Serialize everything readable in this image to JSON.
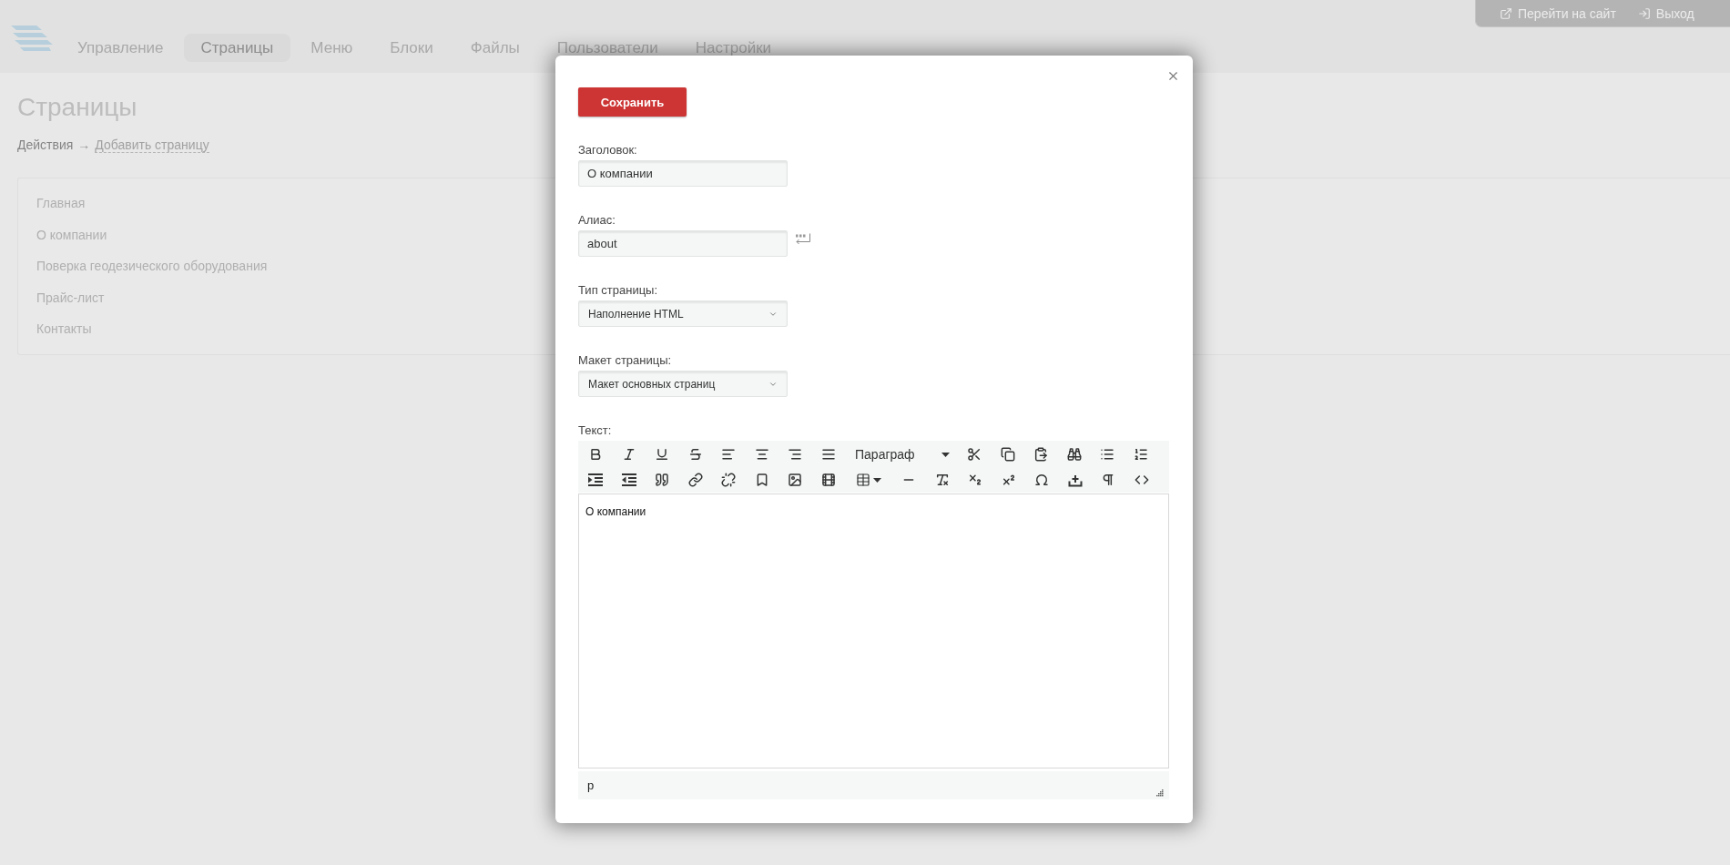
{
  "header": {
    "nav": [
      {
        "label": "Управление",
        "selected": false
      },
      {
        "label": "Страницы",
        "selected": true
      },
      {
        "label": "Меню",
        "selected": false
      },
      {
        "label": "Блоки",
        "selected": false
      },
      {
        "label": "Файлы",
        "selected": false
      },
      {
        "label": "Пользователи",
        "selected": false
      },
      {
        "label": "Настройки",
        "selected": false
      }
    ],
    "links": [
      {
        "kind": "site",
        "label": "Перейти на сайт"
      },
      {
        "kind": "logout",
        "label": "Выход"
      }
    ]
  },
  "page": {
    "title": "Страницы",
    "breadcrumb": {
      "label": "Действия",
      "separator": "→",
      "link": "Добавить страницу"
    },
    "pages": [
      "Главная",
      "О компании",
      "Поверка геодезического оборудования",
      "Прайс-лист",
      "Контакты"
    ]
  },
  "modal": {
    "save_button": "Сохранить",
    "fields": [
      {
        "kind": "input",
        "label": "Заголовок:",
        "value": "О компании"
      },
      {
        "kind": "input",
        "label": "Алиас:",
        "value": "about",
        "translit_button": true
      },
      {
        "kind": "select",
        "label": "Тип страницы:",
        "value": "Наполнение HTML"
      },
      {
        "kind": "select",
        "label": "Макет страницы:",
        "value": "Макет основных страниц"
      }
    ],
    "editor": {
      "label": "Текст:",
      "format": "Параграф",
      "content": "О компании",
      "path": "p"
    }
  }
}
